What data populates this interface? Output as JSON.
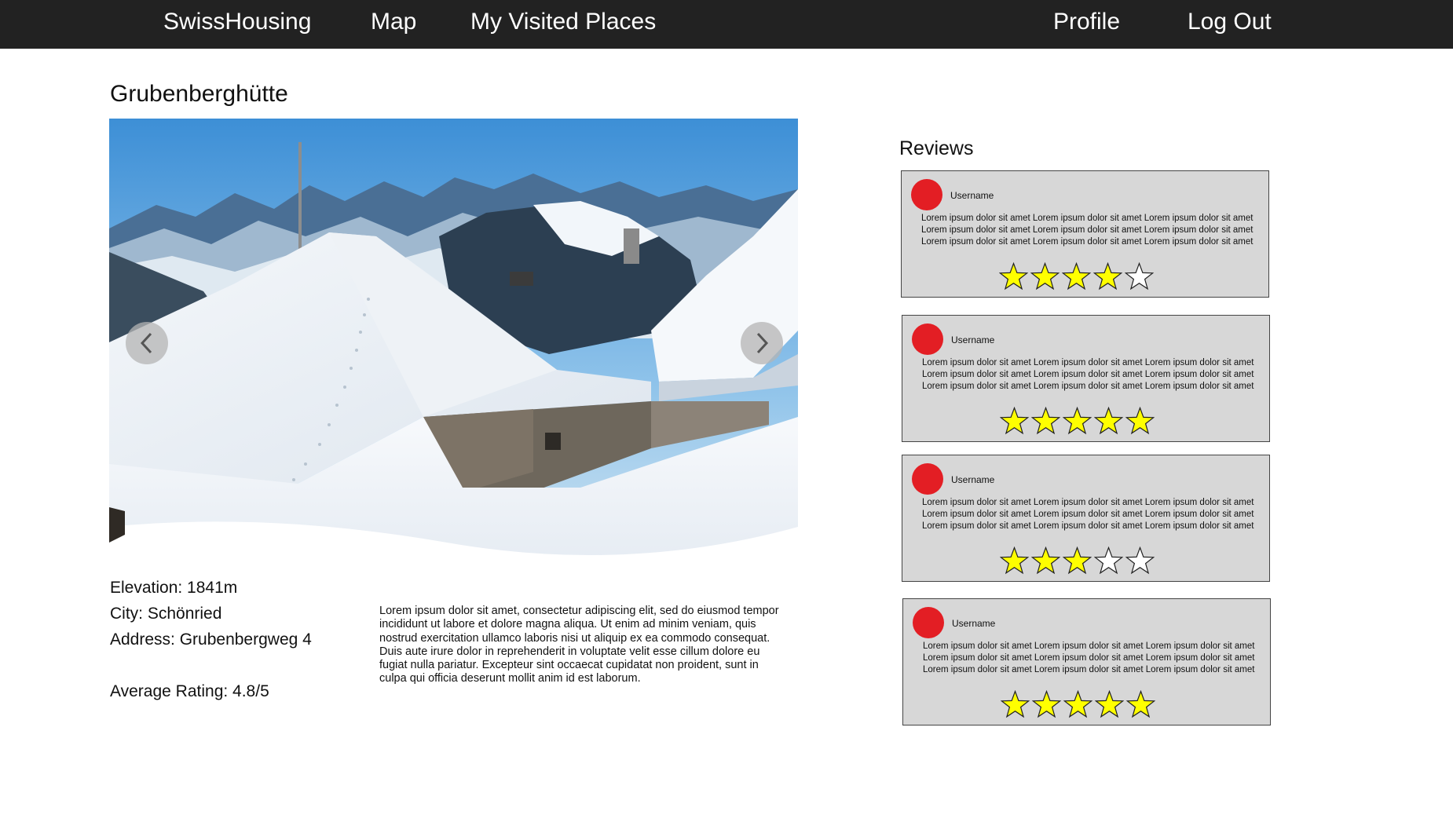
{
  "nav": {
    "brand": "SwissHousing",
    "map": "Map",
    "visited": "My Visited Places",
    "profile": "Profile",
    "logout": "Log Out"
  },
  "place": {
    "title": "Grubenberghütte",
    "elevation": "Elevation: 1841m",
    "city": "City: Schönried",
    "address": "Address: Grubenbergweg 4",
    "average_rating": "Average Rating: 4.8/5",
    "description": "Lorem ipsum dolor sit amet, consectetur adipiscing elit, sed do eiusmod tempor incididunt ut labore et dolore magna aliqua. Ut enim ad minim veniam, quis nostrud exercitation ullamco laboris nisi ut aliquip ex ea commodo consequat. Duis aute irure dolor in reprehenderit in voluptate velit esse cillum dolore eu fugiat nulla pariatur. Excepteur sint occaecat cupidatat non proident, sunt in culpa qui officia deserunt mollit anim id est laborum."
  },
  "carousel": {
    "prev_icon": "chevron-left-icon",
    "next_icon": "chevron-right-icon"
  },
  "reviews": {
    "title": "Reviews",
    "items": [
      {
        "username": "Username",
        "text": "Lorem ipsum dolor sit amet Lorem ipsum dolor sit amet Lorem ipsum dolor sit amet Lorem ipsum dolor sit amet Lorem ipsum dolor sit amet Lorem ipsum dolor sit amet Lorem ipsum dolor sit amet Lorem ipsum dolor sit amet Lorem ipsum dolor sit amet",
        "rating": 4
      },
      {
        "username": "Username",
        "text": "Lorem ipsum dolor sit amet Lorem ipsum dolor sit amet Lorem ipsum dolor sit amet Lorem ipsum dolor sit amet Lorem ipsum dolor sit amet Lorem ipsum dolor sit amet Lorem ipsum dolor sit amet Lorem ipsum dolor sit amet Lorem ipsum dolor sit amet",
        "rating": 5
      },
      {
        "username": "Username",
        "text": "Lorem ipsum dolor sit amet Lorem ipsum dolor sit amet Lorem ipsum dolor sit amet Lorem ipsum dolor sit amet Lorem ipsum dolor sit amet Lorem ipsum dolor sit amet Lorem ipsum dolor sit amet Lorem ipsum dolor sit amet Lorem ipsum dolor sit amet",
        "rating": 3
      },
      {
        "username": "Username",
        "text": "Lorem ipsum dolor sit amet Lorem ipsum dolor sit amet Lorem ipsum dolor sit amet Lorem ipsum dolor sit amet Lorem ipsum dolor sit amet Lorem ipsum dolor sit amet Lorem ipsum dolor sit amet Lorem ipsum dolor sit amet Lorem ipsum dolor sit amet",
        "rating": 5
      }
    ]
  },
  "colors": {
    "nav_bg": "#222222",
    "avatar": "#e31e24",
    "star_filled": "#ffff00",
    "star_empty": "#ffffff",
    "card_bg": "#d7d7d7"
  }
}
